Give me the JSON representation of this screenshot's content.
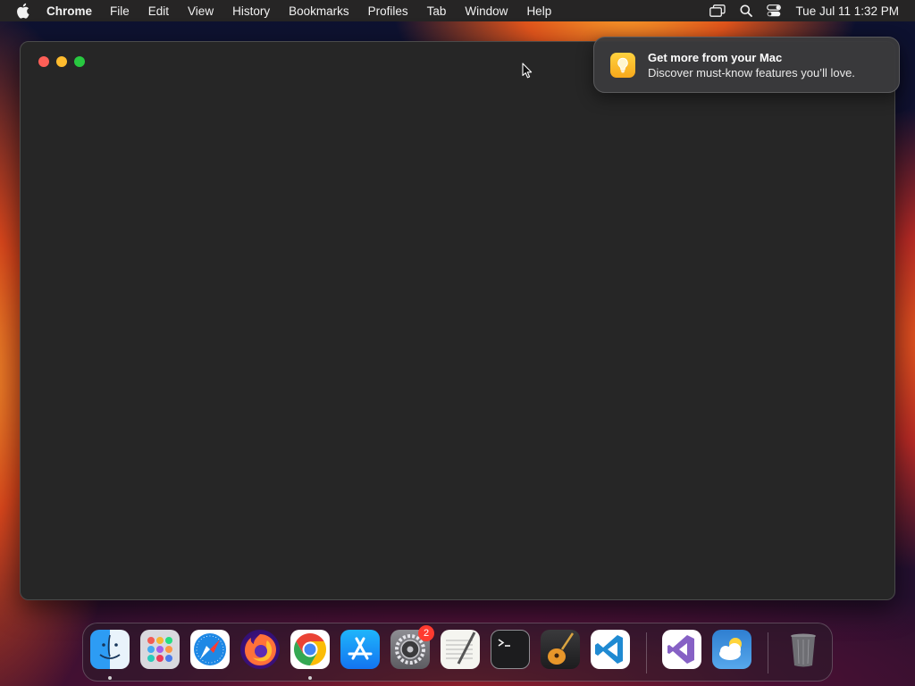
{
  "menubar": {
    "app_name": "Chrome",
    "items": [
      "File",
      "Edit",
      "View",
      "History",
      "Bookmarks",
      "Profiles",
      "Tab",
      "Window",
      "Help"
    ],
    "clock": "Tue Jul 11  1:32 PM"
  },
  "notification": {
    "title": "Get more from your Mac",
    "body": "Discover must-know features you’ll love.",
    "icon": "lightbulb-icon"
  },
  "dock": {
    "items": [
      {
        "name": "finder",
        "running": true
      },
      {
        "name": "launchpad",
        "running": false
      },
      {
        "name": "safari",
        "running": false
      },
      {
        "name": "firefox",
        "running": false
      },
      {
        "name": "chrome",
        "running": true
      },
      {
        "name": "app-store",
        "running": false
      },
      {
        "name": "system-settings",
        "running": false,
        "badge": "2"
      },
      {
        "name": "textedit",
        "running": false
      },
      {
        "name": "terminal",
        "running": false
      },
      {
        "name": "garageband",
        "running": false
      },
      {
        "name": "vscode",
        "running": false
      },
      {
        "name": "visual-studio",
        "running": false
      },
      {
        "name": "weather",
        "running": false
      },
      {
        "name": "trash",
        "running": false
      }
    ]
  },
  "colors": {
    "window_bg": "#262626",
    "menubar_bg": "#262525",
    "traffic_close": "#fe5f57",
    "traffic_minimize": "#febc2e",
    "traffic_maximize": "#28c840",
    "badge": "#ff3b30"
  }
}
